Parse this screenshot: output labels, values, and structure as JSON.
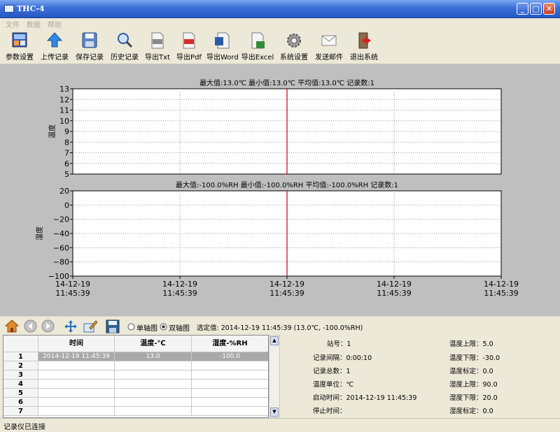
{
  "window": {
    "title": "THC-4",
    "min": "_",
    "max": "□",
    "close": "✕"
  },
  "menu": [
    "文件",
    "数据",
    "帮助"
  ],
  "toolbar": [
    {
      "label": "参数设置",
      "icon": "settings-panel-icon"
    },
    {
      "label": "上传记录",
      "icon": "upload-arrow-icon"
    },
    {
      "label": "保存记录",
      "icon": "save-disk-icon"
    },
    {
      "label": "历史记录",
      "icon": "magnifier-icon"
    },
    {
      "label": "导出Txt",
      "icon": "txt-file-icon"
    },
    {
      "label": "导出Pdf",
      "icon": "pdf-file-icon"
    },
    {
      "label": "导出Word",
      "icon": "word-file-icon"
    },
    {
      "label": "导出Excel",
      "icon": "excel-file-icon"
    },
    {
      "label": "系统设置",
      "icon": "gear-icon"
    },
    {
      "label": "发送邮件",
      "icon": "envelope-icon"
    },
    {
      "label": "退出系统",
      "icon": "exit-door-icon"
    }
  ],
  "chart_data": [
    {
      "type": "line",
      "title": "最大值:13.0℃   最小值:13.0℃   平均值:13.0℃   记录数:1",
      "ylabel": "温度",
      "ylim": [
        5,
        13
      ],
      "yticks": [
        5,
        6,
        7,
        8,
        9,
        10,
        11,
        12,
        13
      ],
      "x": [
        "2014-12-19 11:45:39"
      ],
      "series": [
        {
          "values": [
            13.0
          ]
        }
      ],
      "grid": true
    },
    {
      "type": "line",
      "title": "最大值:-100.0%RH   最小值:-100.0%RH   平均值:-100.0%RH   记录数:1",
      "ylabel": "湿度",
      "ylim": [
        -100,
        20
      ],
      "yticks": [
        -100,
        -80,
        -60,
        -40,
        -20,
        0,
        20
      ],
      "xticks": [
        [
          "14-12-19",
          "11:45:39"
        ],
        [
          "14-12-19",
          "11:45:39"
        ],
        [
          "14-12-19",
          "11:45:39"
        ],
        [
          "14-12-19",
          "11:45:39"
        ],
        [
          "14-12-19",
          "11:45:39"
        ]
      ],
      "x": [
        "2014-12-19 11:45:39"
      ],
      "series": [
        {
          "values": [
            -100.0
          ]
        }
      ],
      "grid": true
    }
  ],
  "bottom": {
    "single_axis": "单轴图",
    "dual_axis": "双轴图",
    "selected_text": "选定值: 2014-12-19 11:45:39 (13.0℃, -100.0%RH)"
  },
  "table": {
    "headers": [
      "时间",
      "温度-℃",
      "湿度-%RH"
    ],
    "rows": [
      {
        "num": "1",
        "time": "2014-12-19 11:45:39",
        "temp": "13.0",
        "hum": "-100.0"
      },
      {
        "num": "2",
        "time": "",
        "temp": "",
        "hum": ""
      },
      {
        "num": "3",
        "time": "",
        "temp": "",
        "hum": ""
      },
      {
        "num": "4",
        "time": "",
        "temp": "",
        "hum": ""
      },
      {
        "num": "5",
        "time": "",
        "temp": "",
        "hum": ""
      },
      {
        "num": "6",
        "time": "",
        "temp": "",
        "hum": ""
      },
      {
        "num": "7",
        "time": "",
        "temp": "",
        "hum": ""
      }
    ]
  },
  "info_left": [
    "站号：1",
    "记录间隔：0:00:10",
    "记录总数：1",
    "温度单位：℃",
    "启动时间：2014-12-19 11:45:39",
    "停止时间："
  ],
  "info_right": [
    "温度上限：5.0",
    "温度下限：-30.0",
    "温度标定：0.0",
    "湿度上限：90.0",
    "湿度下限：20.0",
    "湿度标定：0.0"
  ],
  "status": "记录仪已连接",
  "colors": {
    "title_bar": "#2457c6",
    "plot_bg": "#bfbfbf",
    "marker_line": "#cc0000",
    "selected_row": "#a9a9a9"
  }
}
